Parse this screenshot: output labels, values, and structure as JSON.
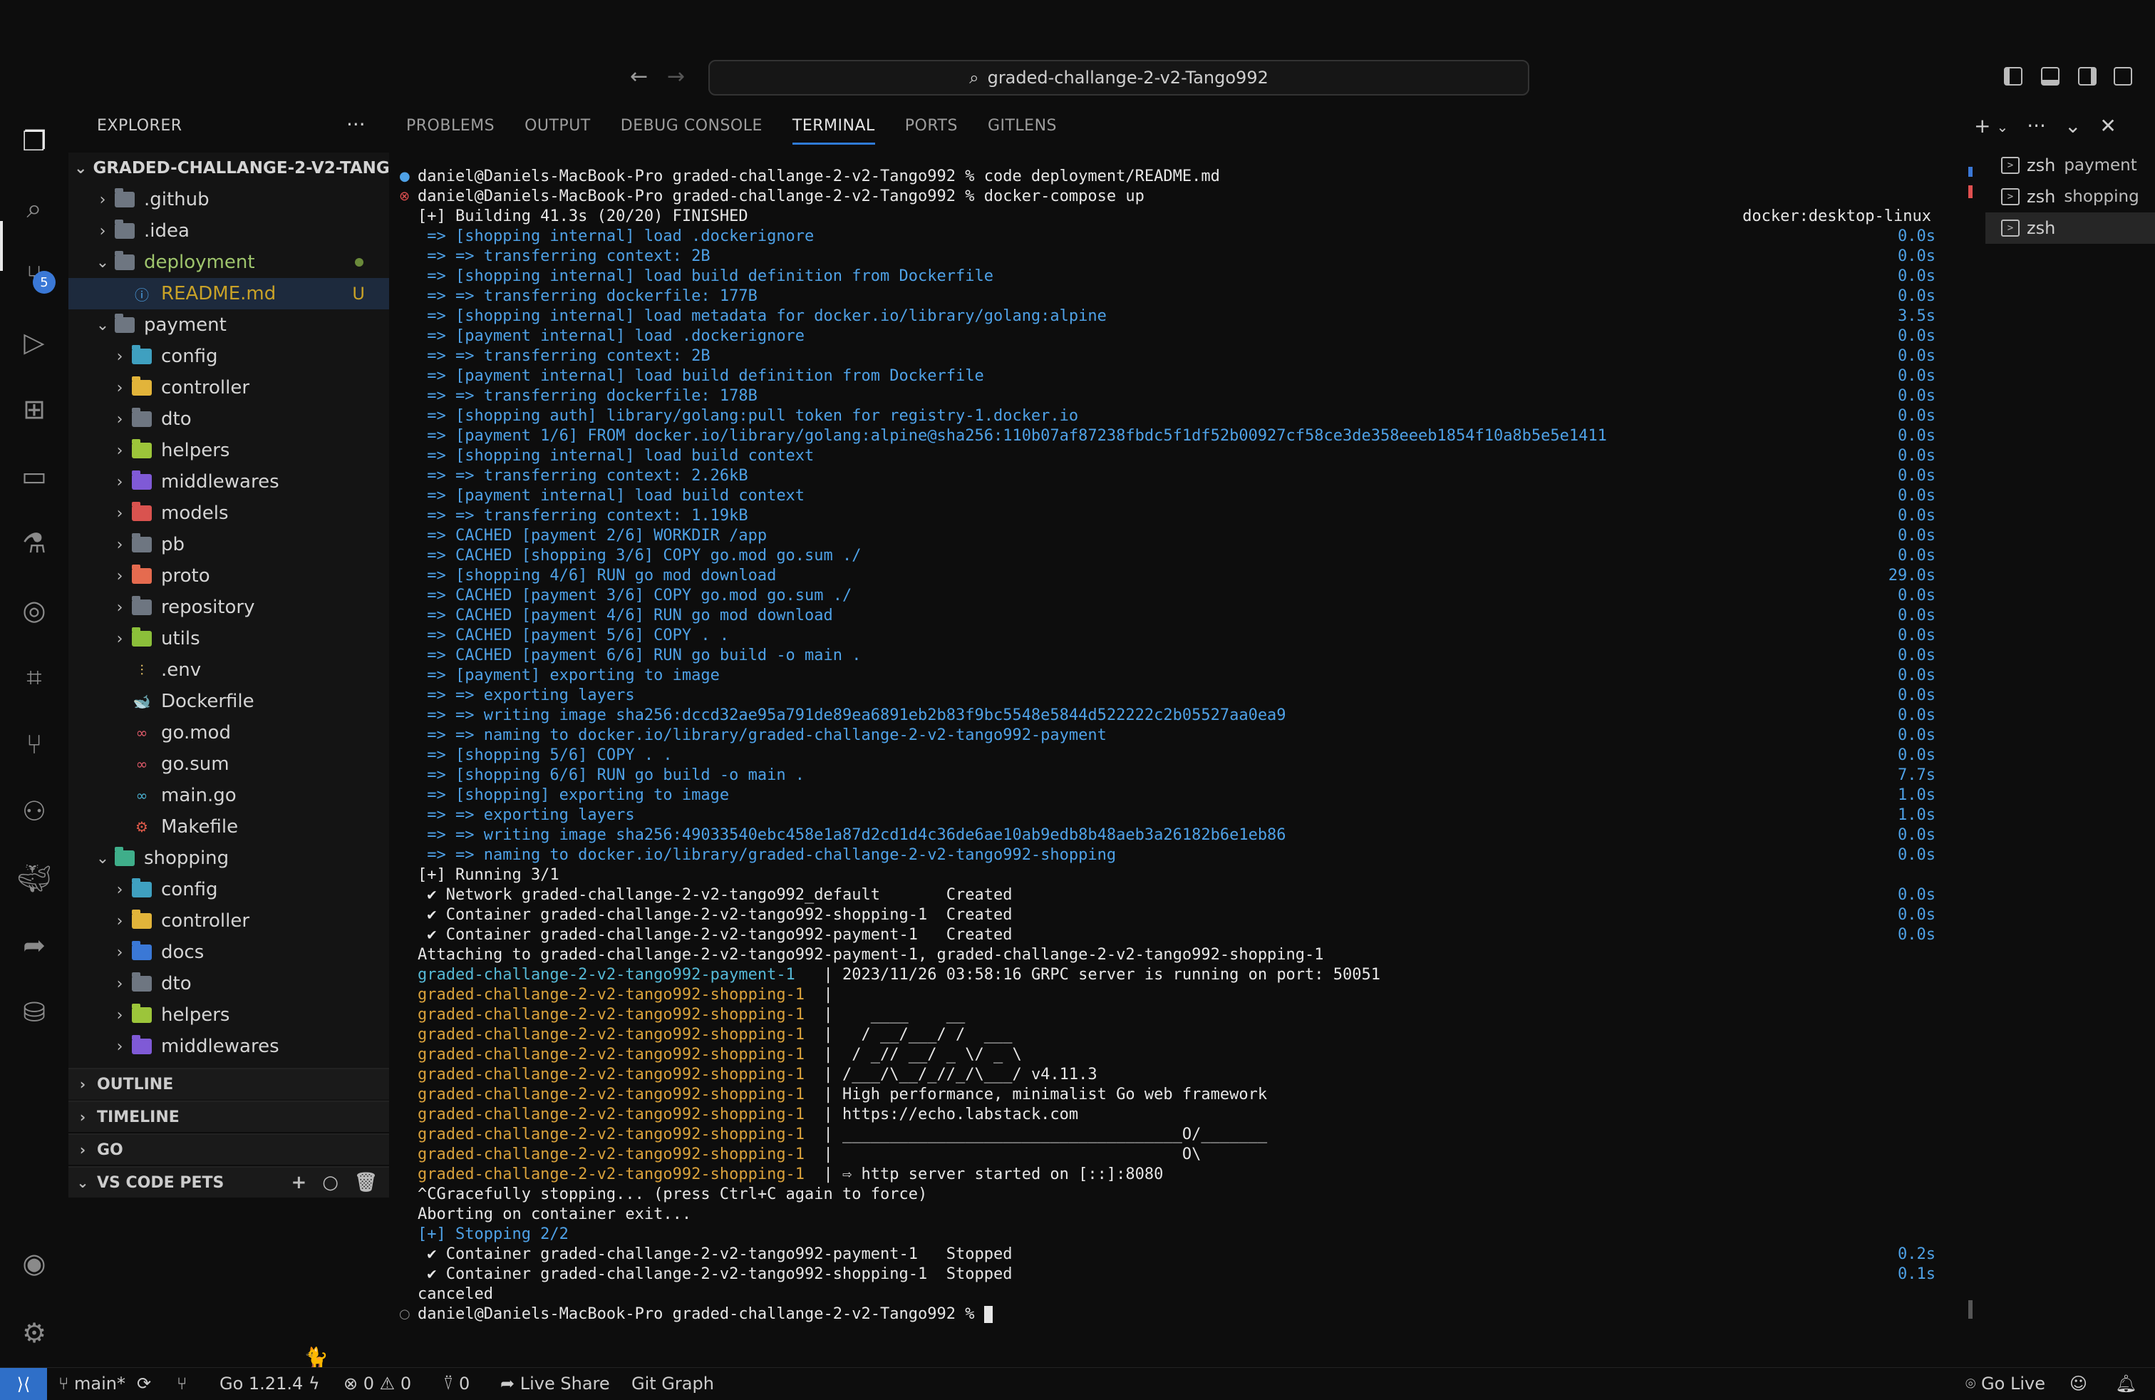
{
  "titlebar": {
    "search_text": "graded-challange-2-v2-Tango992",
    "back_icon": "arrow-left-icon",
    "forward_icon": "arrow-right-icon"
  },
  "activity_bar": {
    "items": [
      "explorer-icon",
      "search-icon",
      "source-control-icon",
      "run-debug-icon",
      "extensions-icon",
      "remote-explorer-icon",
      "testing-icon",
      "gitlens-icon",
      "api-icon",
      "git-graph-icon",
      "containers-icon",
      "docker-icon",
      "live-share-icon",
      "database-icon"
    ],
    "source_control_badge": "5",
    "bottom": [
      "accounts-icon",
      "manage-gear-icon"
    ]
  },
  "sidebar": {
    "title": "EXPLORER",
    "more": "···",
    "root": "GRADED-CHALLANGE-2-V2-TANG...",
    "tree": [
      {
        "label": ".github",
        "depth": 1,
        "chev": "›",
        "color": "#6e7681"
      },
      {
        "label": ".idea",
        "depth": 1,
        "chev": "›",
        "color": "#6e7681"
      },
      {
        "label": "deployment",
        "depth": 1,
        "chev": "⌄",
        "color": "#6e7681",
        "text_color": "#9ec46c",
        "dot": true
      },
      {
        "label": "README.md",
        "depth": 2,
        "chev": "",
        "icon": "ⓘ",
        "icon_color": "#4ea1e6",
        "text_color": "#c9a227",
        "status": "U",
        "selected": true
      },
      {
        "label": "payment",
        "depth": 1,
        "chev": "⌄",
        "color": "#6e7681"
      },
      {
        "label": "config",
        "depth": 2,
        "chev": "›",
        "color": "#3fa0c0"
      },
      {
        "label": "controller",
        "depth": 2,
        "chev": "›",
        "color": "#e2b43a"
      },
      {
        "label": "dto",
        "depth": 2,
        "chev": "›",
        "color": "#6e7681"
      },
      {
        "label": "helpers",
        "depth": 2,
        "chev": "›",
        "color": "#9cc53a"
      },
      {
        "label": "middlewares",
        "depth": 2,
        "chev": "›",
        "color": "#7f5ad6"
      },
      {
        "label": "models",
        "depth": 2,
        "chev": "›",
        "color": "#d9534f"
      },
      {
        "label": "pb",
        "depth": 2,
        "chev": "›",
        "color": "#6e7681"
      },
      {
        "label": "proto",
        "depth": 2,
        "chev": "›",
        "color": "#e56b4f"
      },
      {
        "label": "repository",
        "depth": 2,
        "chev": "›",
        "color": "#6e7681"
      },
      {
        "label": "utils",
        "depth": 2,
        "chev": "›",
        "color": "#8bbf3a"
      },
      {
        "label": ".env",
        "depth": 2,
        "chev": "",
        "icon": "⫶",
        "icon_color": "#e2c066"
      },
      {
        "label": "Dockerfile",
        "depth": 2,
        "chev": "",
        "icon": "🐋",
        "icon_color": "#3a8ad6"
      },
      {
        "label": "go.mod",
        "depth": 2,
        "chev": "",
        "icon": "∞",
        "icon_color": "#e05a6a"
      },
      {
        "label": "go.sum",
        "depth": 2,
        "chev": "",
        "icon": "∞",
        "icon_color": "#e05a6a"
      },
      {
        "label": "main.go",
        "depth": 2,
        "chev": "",
        "icon": "∞",
        "icon_color": "#4ab0d0"
      },
      {
        "label": "Makefile",
        "depth": 2,
        "chev": "",
        "icon": "⚙",
        "icon_color": "#e05a4a"
      },
      {
        "label": "shopping",
        "depth": 1,
        "chev": "⌄",
        "color": "#3fae8a"
      },
      {
        "label": "config",
        "depth": 2,
        "chev": "›",
        "color": "#3fa0c0"
      },
      {
        "label": "controller",
        "depth": 2,
        "chev": "›",
        "color": "#e2b43a"
      },
      {
        "label": "docs",
        "depth": 2,
        "chev": "›",
        "color": "#3a78d6"
      },
      {
        "label": "dto",
        "depth": 2,
        "chev": "›",
        "color": "#6e7681"
      },
      {
        "label": "helpers",
        "depth": 2,
        "chev": "›",
        "color": "#9cc53a"
      },
      {
        "label": "middlewares",
        "depth": 2,
        "chev": "›",
        "color": "#7f5ad6"
      }
    ],
    "sections": [
      "OUTLINE",
      "TIMELINE",
      "GO",
      "VS CODE PETS"
    ]
  },
  "panel": {
    "tabs": [
      "PROBLEMS",
      "OUTPUT",
      "DEBUG CONSOLE",
      "TERMINAL",
      "PORTS",
      "GITLENS"
    ],
    "active_tab": "TERMINAL"
  },
  "terminal": {
    "header_right": "docker:desktop-linux",
    "lines": [
      {
        "t": "daniel@Daniels-MacBook-Pro graded-challange-2-v2-Tango992 % code deployment/README.md",
        "c": "c-white",
        "mark": "●",
        "markc": "#4ea1e6"
      },
      {
        "t": "daniel@Daniels-MacBook-Pro graded-challange-2-v2-Tango992 % docker-compose up",
        "c": "c-white",
        "mark": "⊗",
        "markc": "#e05050"
      },
      {
        "t": "[+] Building 41.3s (20/20) FINISHED",
        "c": "c-white"
      },
      {
        "t": " => [shopping internal] load .dockerignore",
        "c": "c-blue",
        "d": "0.0s"
      },
      {
        "t": " => => transferring context: 2B",
        "c": "c-blue",
        "d": "0.0s"
      },
      {
        "t": " => [shopping internal] load build definition from Dockerfile",
        "c": "c-blue",
        "d": "0.0s"
      },
      {
        "t": " => => transferring dockerfile: 177B",
        "c": "c-blue",
        "d": "0.0s"
      },
      {
        "t": " => [shopping internal] load metadata for docker.io/library/golang:alpine",
        "c": "c-blue",
        "d": "3.5s"
      },
      {
        "t": " => [payment internal] load .dockerignore",
        "c": "c-blue",
        "d": "0.0s"
      },
      {
        "t": " => => transferring context: 2B",
        "c": "c-blue",
        "d": "0.0s"
      },
      {
        "t": " => [payment internal] load build definition from Dockerfile",
        "c": "c-blue",
        "d": "0.0s"
      },
      {
        "t": " => => transferring dockerfile: 178B",
        "c": "c-blue",
        "d": "0.0s"
      },
      {
        "t": " => [shopping auth] library/golang:pull token for registry-1.docker.io",
        "c": "c-blue",
        "d": "0.0s"
      },
      {
        "t": " => [payment 1/6] FROM docker.io/library/golang:alpine@sha256:110b07af87238fbdc5f1df52b00927cf58ce3de358eeeb1854f10a8b5e5e1411",
        "c": "c-blue",
        "d": "0.0s"
      },
      {
        "t": " => [shopping internal] load build context",
        "c": "c-blue",
        "d": "0.0s"
      },
      {
        "t": " => => transferring context: 2.26kB",
        "c": "c-blue",
        "d": "0.0s"
      },
      {
        "t": " => [payment internal] load build context",
        "c": "c-blue",
        "d": "0.0s"
      },
      {
        "t": " => => transferring context: 1.19kB",
        "c": "c-blue",
        "d": "0.0s"
      },
      {
        "t": " => CACHED [payment 2/6] WORKDIR /app",
        "c": "c-blue",
        "d": "0.0s"
      },
      {
        "t": " => CACHED [shopping 3/6] COPY go.mod go.sum ./",
        "c": "c-blue",
        "d": "0.0s"
      },
      {
        "t": " => [shopping 4/6] RUN go mod download",
        "c": "c-blue",
        "d": "29.0s"
      },
      {
        "t": " => CACHED [payment 3/6] COPY go.mod go.sum ./",
        "c": "c-blue",
        "d": "0.0s"
      },
      {
        "t": " => CACHED [payment 4/6] RUN go mod download",
        "c": "c-blue",
        "d": "0.0s"
      },
      {
        "t": " => CACHED [payment 5/6] COPY . .",
        "c": "c-blue",
        "d": "0.0s"
      },
      {
        "t": " => CACHED [payment 6/6] RUN go build -o main .",
        "c": "c-blue",
        "d": "0.0s"
      },
      {
        "t": " => [payment] exporting to image",
        "c": "c-blue",
        "d": "0.0s"
      },
      {
        "t": " => => exporting layers",
        "c": "c-blue",
        "d": "0.0s"
      },
      {
        "t": " => => writing image sha256:dccd32ae95a791de89ea6891eb2b83f9bc5548e5844d522222c2b05527aa0ea9",
        "c": "c-blue",
        "d": "0.0s"
      },
      {
        "t": " => => naming to docker.io/library/graded-challange-2-v2-tango992-payment",
        "c": "c-blue",
        "d": "0.0s"
      },
      {
        "t": " => [shopping 5/6] COPY . .",
        "c": "c-blue",
        "d": "0.0s"
      },
      {
        "t": " => [shopping 6/6] RUN go build -o main .",
        "c": "c-blue",
        "d": "7.7s"
      },
      {
        "t": " => [shopping] exporting to image",
        "c": "c-blue",
        "d": "1.0s"
      },
      {
        "t": " => => exporting layers",
        "c": "c-blue",
        "d": "1.0s"
      },
      {
        "t": " => => writing image sha256:49033540ebc458e1a87d2cd1d4c36de6ae10ab9edb8b48aeb3a26182b6e1eb86",
        "c": "c-blue",
        "d": "0.0s"
      },
      {
        "t": " => => naming to docker.io/library/graded-challange-2-v2-tango992-shopping",
        "c": "c-blue",
        "d": "0.0s"
      },
      {
        "t": "[+] Running 3/1",
        "c": "c-white"
      },
      {
        "t": " ✔ Network graded-challange-2-v2-tango992_default       Created",
        "c": "c-white",
        "d": "0.0s"
      },
      {
        "t": " ✔ Container graded-challange-2-v2-tango992-shopping-1  Created",
        "c": "c-white",
        "d": "0.0s"
      },
      {
        "t": " ✔ Container graded-challange-2-v2-tango992-payment-1   Created",
        "c": "c-white",
        "d": "0.0s"
      },
      {
        "t": "Attaching to graded-challange-2-v2-tango992-payment-1, graded-challange-2-v2-tango992-shopping-1",
        "c": "c-white"
      },
      {
        "pre": "graded-challange-2-v2-tango992-payment-1   ",
        "prec": "c-cyan",
        "t": "| 2023/11/26 03:58:16 GRPC server is running on port: 50051",
        "c": "c-white"
      },
      {
        "pre": "graded-challange-2-v2-tango992-shopping-1  ",
        "prec": "c-orange",
        "t": "| ",
        "c": "c-white"
      },
      {
        "pre": "graded-challange-2-v2-tango992-shopping-1  ",
        "prec": "c-orange",
        "t": "|    ____    __",
        "c": "c-white"
      },
      {
        "pre": "graded-challange-2-v2-tango992-shopping-1  ",
        "prec": "c-orange",
        "t": "|   / __/___/ /  ___",
        "c": "c-white"
      },
      {
        "pre": "graded-challange-2-v2-tango992-shopping-1  ",
        "prec": "c-orange",
        "t": "|  / _// __/ _ \\/ _ \\",
        "c": "c-white"
      },
      {
        "pre": "graded-challange-2-v2-tango992-shopping-1  ",
        "prec": "c-orange",
        "t": "| /___/\\__/_//_/\\___/ v4.11.3",
        "c": "c-white"
      },
      {
        "pre": "graded-challange-2-v2-tango992-shopping-1  ",
        "prec": "c-orange",
        "t": "| High performance, minimalist Go web framework",
        "c": "c-white"
      },
      {
        "pre": "graded-challange-2-v2-tango992-shopping-1  ",
        "prec": "c-orange",
        "t": "| https://echo.labstack.com",
        "c": "c-white"
      },
      {
        "pre": "graded-challange-2-v2-tango992-shopping-1  ",
        "prec": "c-orange",
        "t": "| ____________________________________O/_______",
        "c": "c-white"
      },
      {
        "pre": "graded-challange-2-v2-tango992-shopping-1  ",
        "prec": "c-orange",
        "t": "|                                     O\\",
        "c": "c-white"
      },
      {
        "pre": "graded-challange-2-v2-tango992-shopping-1  ",
        "prec": "c-orange",
        "t": "| ⇨ http server started on [::]:8080",
        "c": "c-white"
      },
      {
        "t": "^CGracefully stopping... (press Ctrl+C again to force)",
        "c": "c-white"
      },
      {
        "t": "Aborting on container exit...",
        "c": "c-white"
      },
      {
        "t": "[+] Stopping 2/2",
        "c": "c-blue"
      },
      {
        "t": " ✔ Container graded-challange-2-v2-tango992-payment-1   Stopped",
        "c": "c-white",
        "d": "0.2s"
      },
      {
        "t": " ✔ Container graded-challange-2-v2-tango992-shopping-1  Stopped",
        "c": "c-white",
        "d": "0.1s"
      },
      {
        "t": "canceled",
        "c": "c-white"
      },
      {
        "t": "daniel@Daniels-MacBook-Pro graded-challange-2-v2-Tango992 % ",
        "c": "c-white",
        "mark": "○",
        "markc": "#888",
        "cursor": true
      }
    ]
  },
  "terminal_list": [
    {
      "name": "zsh",
      "sub": "payment"
    },
    {
      "name": "zsh",
      "sub": "shopping"
    },
    {
      "name": "zsh",
      "sub": "",
      "active": true
    }
  ],
  "statusbar": {
    "branch": "main*",
    "go_version": "Go 1.21.4",
    "errors": "0",
    "warnings": "0",
    "ports": "0",
    "live_share": "Live Share",
    "git_graph": "Git Graph",
    "go_live": "Go Live"
  }
}
